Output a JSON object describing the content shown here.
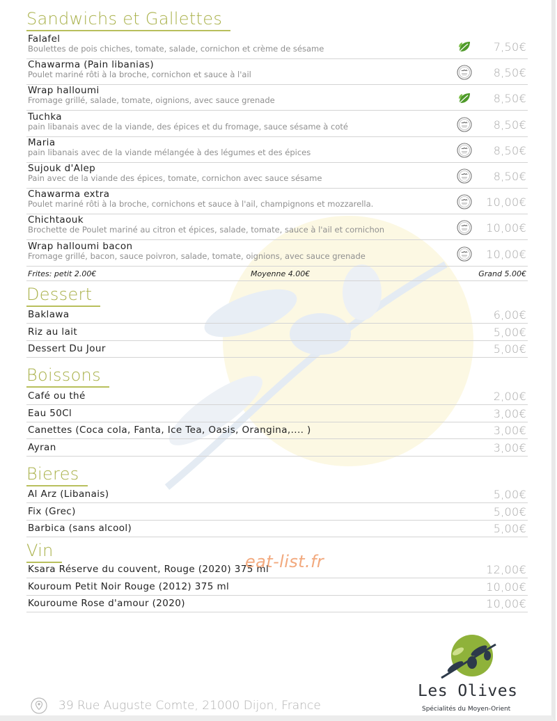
{
  "sections": {
    "sandwichs": {
      "title": "Sandwichs et Gallettes",
      "items": [
        {
          "name": "Falafel",
          "desc": "Boulettes de pois chiches, tomate, salade, cornichon et crème de sésame",
          "price": "7,50€",
          "icon": "leaf-icon"
        },
        {
          "name": "Chawarma (Pain libanias)",
          "desc": "Poulet mariné rôti à la broche, cornichon et sauce à l'ail",
          "price": "8,50€",
          "icon": "halal-icon"
        },
        {
          "name": "Wrap halloumi",
          "desc": "Fromage grillé, salade, tomate, oignions, avec sauce grenade",
          "price": "8,50€",
          "icon": "leaf-icon"
        },
        {
          "name": "Tuchka",
          "desc": "pain libanais avec de la viande, des épices et du fromage, sauce sésame à coté",
          "price": "8,50€",
          "icon": "halal-icon"
        },
        {
          "name": "Maria",
          "desc": "pain libanais avec de la viande mélangée à des légumes et des épices",
          "price": "8,50€",
          "icon": "halal-icon"
        },
        {
          "name": "Sujouk d'Alep",
          "desc": "Pain avec de la viande des épices, tomate, cornichon avec sauce sésame",
          "price": "8,50€",
          "icon": "halal-icon"
        },
        {
          "name": "Chawarma extra",
          "desc": "Poulet mariné rôti à la broche, cornichons et sauce à l'ail, champignons et mozzarella.",
          "price": "10,00€",
          "icon": "halal-icon"
        },
        {
          "name": "Chichtaouk",
          "desc": "Brochette de Poulet mariné au citron et épices, salade, tomate, sauce à l'ail et cornichon",
          "price": "10,00€",
          "icon": "halal-icon"
        },
        {
          "name": "Wrap halloumi bacon",
          "desc": "Fromage grillé, bacon, sauce poivron, salade, tomate, oignions, avec sauce grenade",
          "price": "10,00€",
          "icon": "halal-icon"
        }
      ],
      "fries": {
        "label": "Frites: petit 2.00€",
        "medium": "Moyenne 4.00€",
        "large": "Grand 5.00€"
      }
    },
    "dessert": {
      "title": "Dessert",
      "items": [
        {
          "name": "Baklawa",
          "price": "6,00€"
        },
        {
          "name": "Riz au lait",
          "price": "5,00€"
        },
        {
          "name": "Dessert Du Jour",
          "price": "5,00€"
        }
      ]
    },
    "boissons": {
      "title": "Boissons",
      "items": [
        {
          "name": "Café ou thé",
          "price": "2,00€"
        },
        {
          "name": "Eau 50Cl",
          "price": "3,00€"
        },
        {
          "name": "Canettes (Coca cola, Fanta, Ice Tea, Oasis, Orangina,.... )",
          "price": "3,00€"
        },
        {
          "name": "Ayran",
          "price": "3,00€"
        }
      ]
    },
    "bieres": {
      "title": "Bieres",
      "items": [
        {
          "name": "Al Arz (Libanais)",
          "price": "5,00€"
        },
        {
          "name": "Fix (Grec)",
          "price": "5,00€"
        },
        {
          "name": "Barbica (sans alcool)",
          "price": "5,00€"
        }
      ]
    },
    "vin": {
      "title": "Vin",
      "items": [
        {
          "name": "Ksara Réserve du couvent, Rouge (2020) 375 ml",
          "price": "12,00€"
        },
        {
          "name": "Kouroum Petit Noir Rouge (2012) 375 ml",
          "price": "10,00€"
        },
        {
          "name": "Kouroume Rose d'amour (2020)",
          "price": "10,00€"
        }
      ]
    }
  },
  "watermark": "eat-list.fr",
  "footer": {
    "address": "39 Rue Auguste Comte, 21000 Dijon, France",
    "icon": "location-pin-icon"
  },
  "logo": {
    "name": "Les Olives",
    "tagline": "Spécialités du Moyen-Orient",
    "icon": "olive-branch-icon"
  },
  "colors": {
    "accent": "#a9b14a",
    "price": "#a9a9a9",
    "desc": "#8f8f8f",
    "leaf": "#5a9e2e",
    "watermark": "#f2a97e"
  }
}
